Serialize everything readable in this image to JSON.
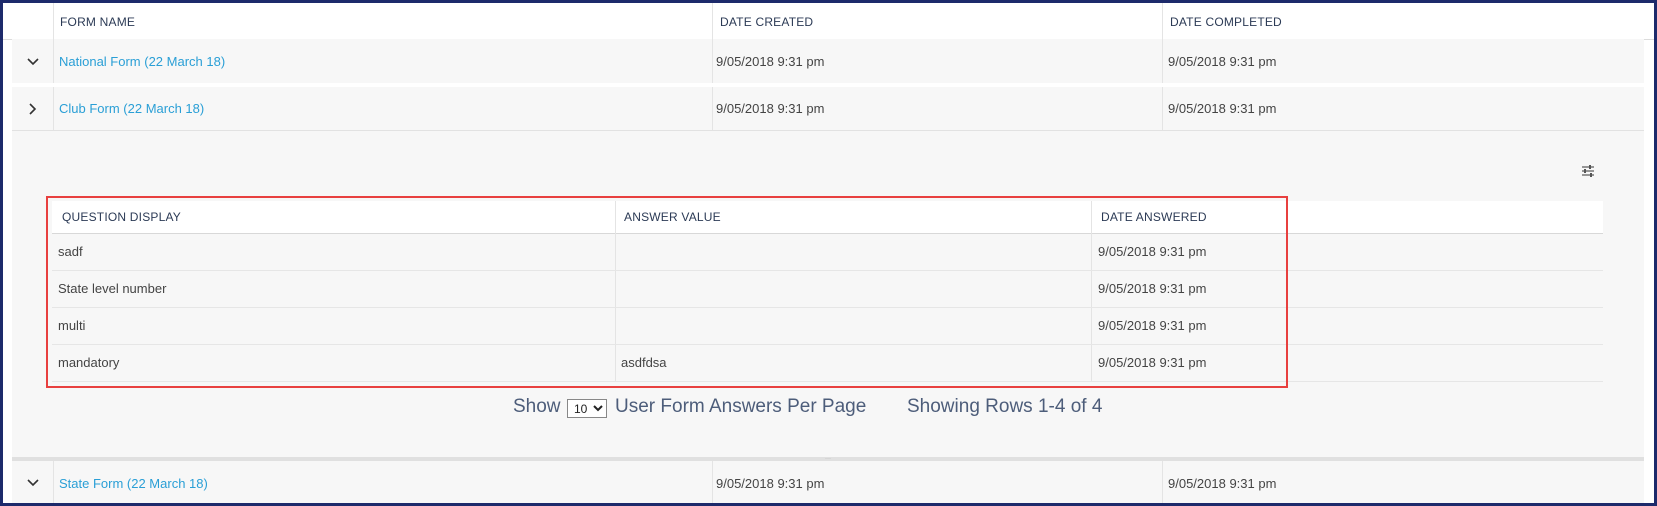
{
  "main_table": {
    "headers": {
      "form_name": "FORM NAME",
      "date_created": "DATE CREATED",
      "date_completed": "DATE COMPLETED"
    },
    "rows": [
      {
        "name": "National Form (22 March 18)",
        "date_created": "9/05/2018 9:31 pm",
        "date_completed": "9/05/2018 9:31 pm",
        "expand_icon": "chevron-down-icon"
      },
      {
        "name": "Club Form (22 March 18)",
        "date_created": "9/05/2018 9:31 pm",
        "date_completed": "9/05/2018 9:31 pm",
        "expand_icon": "chevron-right-icon"
      },
      {
        "name": "State Form (22 March 18)",
        "date_created": "9/05/2018 9:31 pm",
        "date_completed": "9/05/2018 9:31 pm",
        "expand_icon": "chevron-down-icon"
      }
    ]
  },
  "sub_table": {
    "settings_icon": "sliders-icon",
    "headers": {
      "question": "QUESTION DISPLAY",
      "answer": "ANSWER VALUE",
      "date_answered": "DATE ANSWERED"
    },
    "rows": [
      {
        "question": "sadf",
        "answer": "",
        "date_answered": "9/05/2018 9:31 pm"
      },
      {
        "question": "State level number",
        "answer": "",
        "date_answered": "9/05/2018 9:31 pm"
      },
      {
        "question": "multi",
        "answer": "",
        "date_answered": "9/05/2018 9:31 pm"
      },
      {
        "question": "mandatory",
        "answer": "asdfdsa",
        "date_answered": "9/05/2018 9:31 pm"
      }
    ]
  },
  "pager": {
    "show_label": "Show",
    "per_page_value": "10",
    "per_page_label": "User Form Answers Per Page",
    "showing_rows": "Showing Rows 1-4 of 4"
  },
  "colors": {
    "link": "#2a9fd6",
    "highlight_border": "#e8403f",
    "frame_border": "#1d2a6b"
  }
}
